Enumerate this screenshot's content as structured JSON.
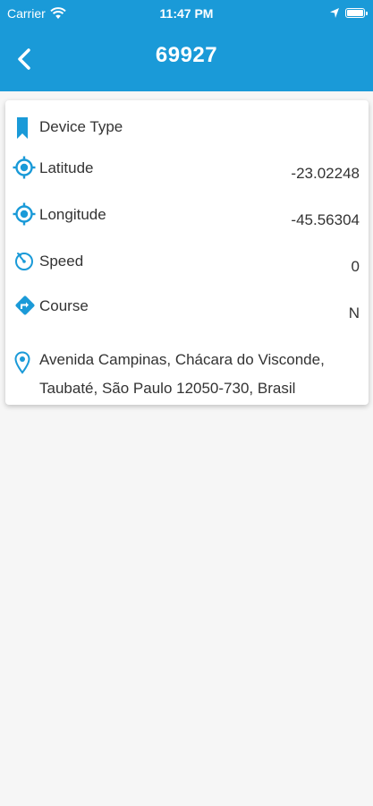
{
  "status_bar": {
    "carrier": "Carrier",
    "time": "11:47 PM"
  },
  "header": {
    "title": "69927",
    "back_icon": "chevron-left-icon"
  },
  "theme": {
    "accent": "#1a9ad8",
    "background": "#f6f6f6"
  },
  "details": {
    "device_type": {
      "label": "Device Type",
      "icon": "bookmark-icon"
    },
    "latitude": {
      "label": "Latitude",
      "value": "-23.02248",
      "icon": "gps-target-icon"
    },
    "longitude": {
      "label": "Longitude",
      "value": "-45.56304",
      "icon": "gps-target-icon"
    },
    "speed": {
      "label": "Speed",
      "value": "0",
      "icon": "speedometer-icon"
    },
    "course": {
      "label": "Course",
      "value": "N",
      "icon": "direction-sign-icon"
    },
    "address": {
      "text": "Avenida Campinas, Chácara do Visconde, Taubaté, São Paulo 12050-730, Brasil",
      "icon": "map-pin-icon"
    }
  }
}
